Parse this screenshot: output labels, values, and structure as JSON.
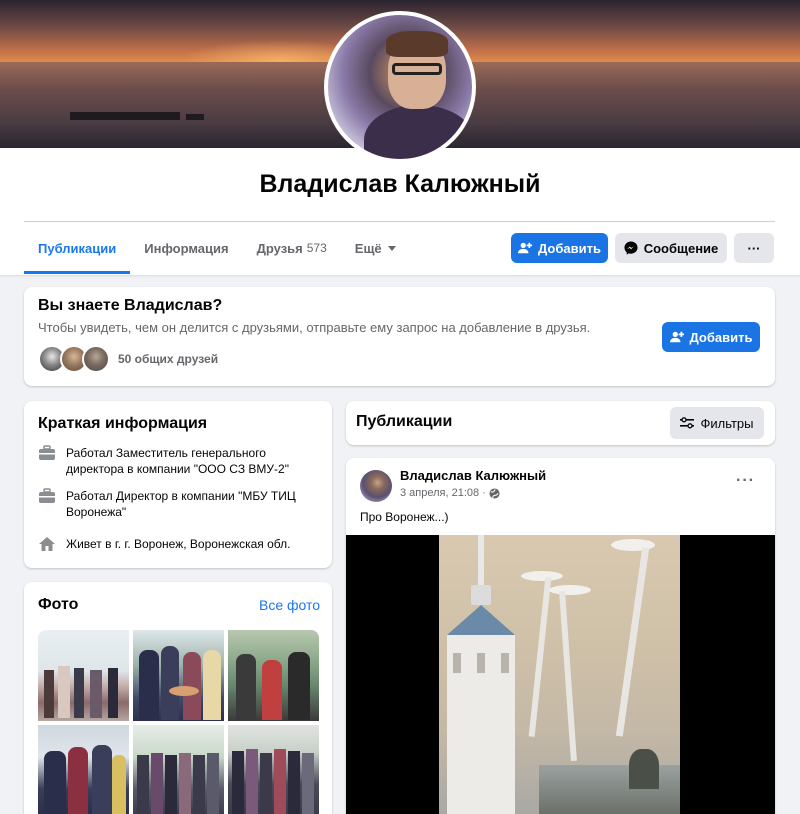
{
  "profile": {
    "name": "Владислав Калюжный"
  },
  "tabs": [
    {
      "label": "Публикации"
    },
    {
      "label": "Информация"
    },
    {
      "label": "Друзья",
      "count": "573"
    },
    {
      "label": "Ещё"
    }
  ],
  "actions": {
    "add_label": "Добавить",
    "message_label": "Сообщение",
    "more_label": "···"
  },
  "know_card": {
    "title": "Вы знаете Владислав?",
    "subtitle": "Чтобы увидеть, чем он делится с друзьями, отправьте ему запрос на добавление в друзья.",
    "mutual_friends": "50 общих друзей",
    "add_label": "Добавить"
  },
  "intro": {
    "title": "Краткая информация",
    "items": [
      {
        "icon": "briefcase-icon",
        "text": "Работал Заместитель генерального директора в компании \"ООО СЗ ВМУ-2\""
      },
      {
        "icon": "briefcase-icon",
        "text": "Работал Директор в компании \"МБУ ТИЦ Воронежа\""
      },
      {
        "icon": "home-icon",
        "text": "Живет в г. г. Воронеж, Воронежская обл."
      }
    ]
  },
  "photos": {
    "title": "Фото",
    "see_all": "Все фото"
  },
  "posts_header": {
    "title": "Публикации",
    "filters_label": "Фильтры"
  },
  "post": {
    "author": "Владислав Калюжный",
    "date": "3 апреля, 21:08",
    "separator": "·",
    "text": "Про Воронеж...)",
    "more": "···"
  },
  "colors": {
    "accent": "#1877f2",
    "button_blue": "#1b74e4",
    "button_grey": "#e4e6eb",
    "background": "#f0f2f5"
  }
}
